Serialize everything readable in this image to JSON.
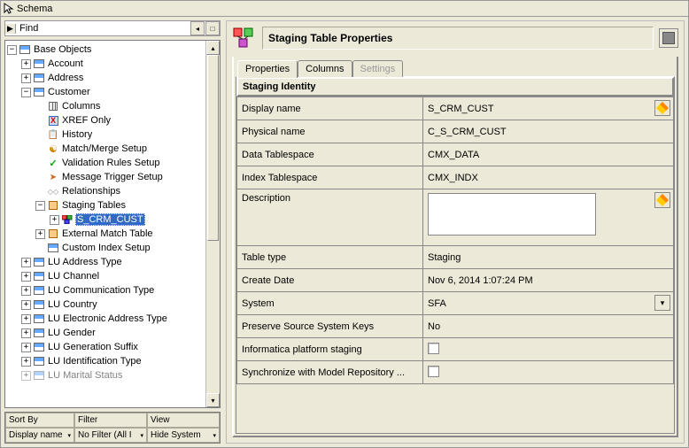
{
  "window": {
    "title": "Schema"
  },
  "find": {
    "label": "Find"
  },
  "tree": {
    "root": "Base Objects",
    "items": [
      "Account",
      "Address",
      "Customer",
      "Columns",
      "XREF Only",
      "History",
      "Match/Merge Setup",
      "Validation Rules Setup",
      "Message Trigger Setup",
      "Relationships",
      "Staging Tables",
      "S_CRM_CUST",
      "External Match Table",
      "Custom Index Setup",
      "LU Address Type",
      "LU Channel",
      "LU Communication Type",
      "LU Country",
      "LU Electronic Address Type",
      "LU Gender",
      "LU Generation Suffix",
      "LU Identification Type",
      "LU Marital Status"
    ]
  },
  "grid": {
    "headers": [
      "Sort By",
      "Filter",
      "View"
    ],
    "values": [
      "Display name",
      "No Filter (All I",
      "Hide System "
    ]
  },
  "right": {
    "title": "Staging Table Properties",
    "tabs": [
      "Properties",
      "Columns",
      "Settings"
    ],
    "section": "Staging Identity",
    "rows": [
      {
        "label": "Display name",
        "value": "S_CRM_CUST",
        "edit": true
      },
      {
        "label": "Physical name",
        "value": "C_S_CRM_CUST"
      },
      {
        "label": "Data Tablespace",
        "value": "CMX_DATA"
      },
      {
        "label": "Index Tablespace",
        "value": "CMX_INDX"
      },
      {
        "label": "Description",
        "value": "",
        "desc": true
      },
      {
        "label": "Table type",
        "value": "Staging"
      },
      {
        "label": "Create Date",
        "value": "Nov 6, 2014 1:07:24 PM"
      },
      {
        "label": "System",
        "value": "SFA",
        "dropdown": true
      },
      {
        "label": "Preserve Source System Keys",
        "value": "No"
      },
      {
        "label": "Informatica platform staging",
        "checkbox": true
      },
      {
        "label": "Synchronize with Model Repository ...",
        "checkbox": true
      }
    ]
  },
  "chart_data": {
    "type": "table",
    "title": "Staging Identity",
    "rows": [
      [
        "Display name",
        "S_CRM_CUST"
      ],
      [
        "Physical name",
        "C_S_CRM_CUST"
      ],
      [
        "Data Tablespace",
        "CMX_DATA"
      ],
      [
        "Index Tablespace",
        "CMX_INDX"
      ],
      [
        "Description",
        ""
      ],
      [
        "Table type",
        "Staging"
      ],
      [
        "Create Date",
        "Nov 6, 2014 1:07:24 PM"
      ],
      [
        "System",
        "SFA"
      ],
      [
        "Preserve Source System Keys",
        "No"
      ],
      [
        "Informatica platform staging",
        false
      ],
      [
        "Synchronize with Model Repository ...",
        false
      ]
    ]
  }
}
